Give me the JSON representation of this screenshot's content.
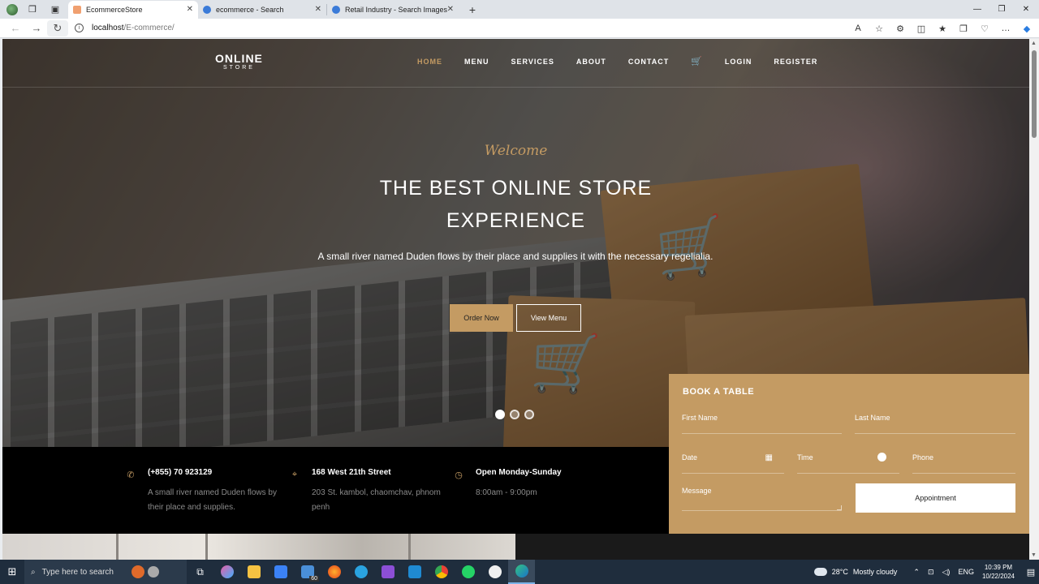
{
  "browser": {
    "tabs": [
      {
        "title": "EcommerceStore",
        "active": true,
        "favicon_color": "#f0a070"
      },
      {
        "title": "ecommerce - Search",
        "active": false,
        "favicon_color": "#3b7bd8"
      },
      {
        "title": "Retail Industry - Search Images",
        "active": false,
        "favicon_color": "#3b7bd8"
      }
    ],
    "url_host": "localhost",
    "url_path": "/E-commerce/",
    "window_controls": [
      "—",
      "❐",
      "✕"
    ]
  },
  "site": {
    "logo_main": "ONLINE",
    "logo_sub": "STORE",
    "nav": [
      {
        "label": "HOME",
        "active": true
      },
      {
        "label": "MENU",
        "active": false
      },
      {
        "label": "SERVICES",
        "active": false
      },
      {
        "label": "ABOUT",
        "active": false
      },
      {
        "label": "CONTACT",
        "active": false
      },
      {
        "label": "cart-icon",
        "active": false
      },
      {
        "label": "LOGIN",
        "active": false
      },
      {
        "label": "REGISTER",
        "active": false
      }
    ],
    "accent_color": "#c49b63"
  },
  "hero": {
    "welcome": "Welcome",
    "headline_line1": "THE BEST ONLINE STORE",
    "headline_line2": "EXPERIENCE",
    "subtext": "A small river named Duden flows by their place and supplies it with the necessary regelialia.",
    "btn_order": "Order Now",
    "btn_menu": "View Menu",
    "slides": 3,
    "active_slide": 1
  },
  "info": [
    {
      "icon": "phone-icon",
      "title": "(+855) 70 923129",
      "desc": "A small river named Duden flows by their place and supplies."
    },
    {
      "icon": "location-icon",
      "title": "168 West 21th Street",
      "desc": "203 St. kambol, chaomchav, phnom penh"
    },
    {
      "icon": "clock-icon",
      "title": "Open Monday-Sunday",
      "desc": "8:00am - 9:00pm"
    }
  ],
  "booking": {
    "title": "BOOK A TABLE",
    "first_name": "First Name",
    "last_name": "Last Name",
    "date": "Date",
    "time": "Time",
    "phone": "Phone",
    "message": "Message",
    "button": "Appointment"
  },
  "taskbar": {
    "search_placeholder": "Type here to search",
    "weather_temp": "28°C",
    "weather_desc": "Mostly cloudy",
    "lang": "ENG",
    "time": "10:39 PM",
    "date": "10/22/2024",
    "badge": "60"
  }
}
